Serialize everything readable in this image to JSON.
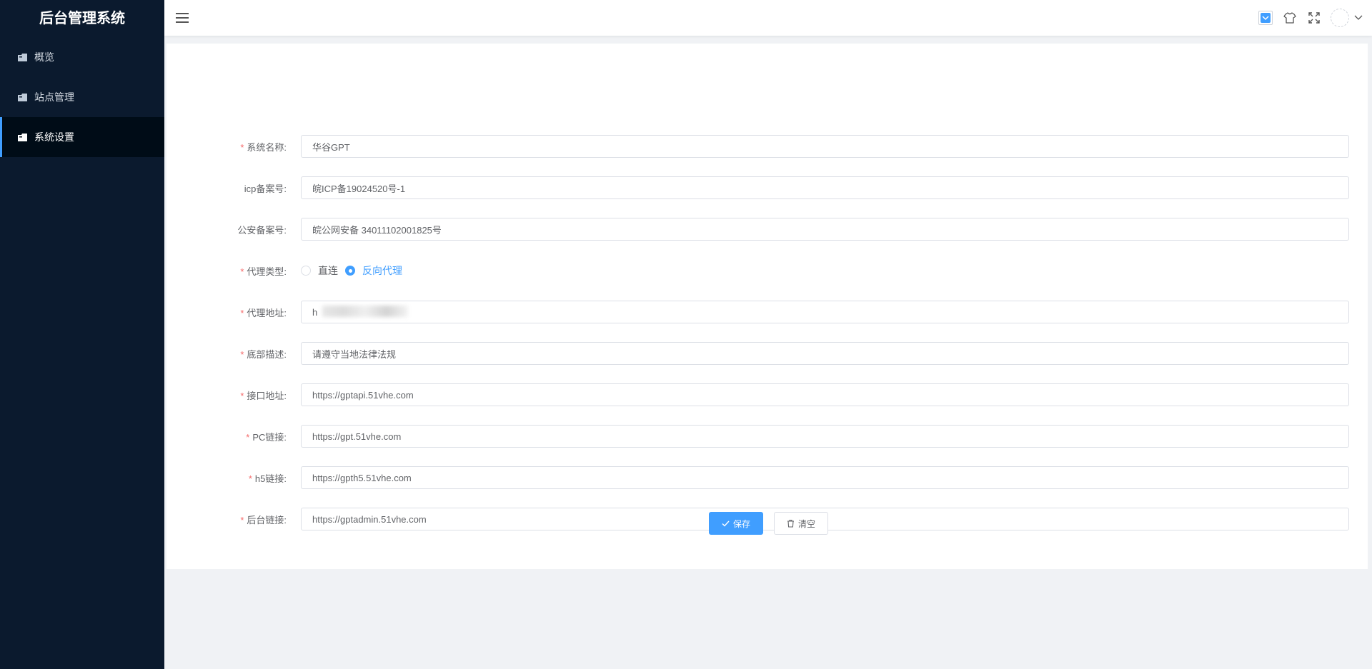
{
  "sidebar": {
    "title": "后台管理系统",
    "items": [
      {
        "label": "概览",
        "icon": "folder-icon",
        "active": false
      },
      {
        "label": "站点管理",
        "icon": "folder-icon",
        "active": false
      },
      {
        "label": "系统设置",
        "icon": "folder-icon",
        "active": true
      }
    ]
  },
  "header": {
    "icons": [
      "checkbox-icon",
      "tshirt-icon",
      "fullscreen-icon",
      "avatar",
      "chevron-down-icon"
    ]
  },
  "form": {
    "fields": [
      {
        "label": "系统名称:",
        "required": true,
        "value": "华谷GPT"
      },
      {
        "label": "icp备案号:",
        "required": false,
        "value": "皖ICP备19024520号-1"
      },
      {
        "label": "公安备案号:",
        "required": false,
        "value": "皖公网安备 34011102001825号"
      },
      {
        "label": "代理类型:",
        "required": true
      },
      {
        "label": "代理地址:",
        "required": true,
        "value": "h"
      },
      {
        "label": "底部描述:",
        "required": true,
        "value": "请遵守当地法律法规"
      },
      {
        "label": "接口地址:",
        "required": true,
        "value": "https://gptapi.51vhe.com"
      },
      {
        "label": "PC链接:",
        "required": true,
        "value": "https://gpt.51vhe.com"
      },
      {
        "label": "h5链接:",
        "required": true,
        "value": "https://gpth5.51vhe.com"
      },
      {
        "label": "后台链接:",
        "required": true,
        "value": "https://gptadmin.51vhe.com"
      }
    ],
    "proxy_type": {
      "options": [
        "直连",
        "反向代理"
      ],
      "selected": "反向代理"
    },
    "save_label": "保存",
    "clear_label": "清空"
  },
  "colors": {
    "sidebar_bg": "#0b1a2e",
    "primary": "#409eff",
    "required": "#f56c6c"
  }
}
